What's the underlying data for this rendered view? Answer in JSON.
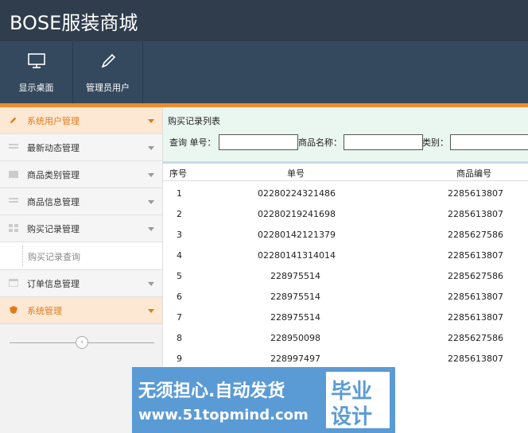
{
  "app": {
    "title": "BOSE服装商城"
  },
  "toolbar": [
    {
      "label": "显示桌面",
      "icon": "monitor-icon"
    },
    {
      "label": "管理员用户",
      "icon": "pen-icon"
    }
  ],
  "sidebar": {
    "items": [
      {
        "label": "系统用户管理",
        "icon": "pencil-icon",
        "active": true
      },
      {
        "label": "最新动态管理",
        "icon": "list-icon"
      },
      {
        "label": "商品类别管理",
        "icon": "folder-icon"
      },
      {
        "label": "商品信息管理",
        "icon": "list-icon"
      },
      {
        "label": "购买记录管理",
        "icon": "grid-icon"
      },
      {
        "label": "订单信息管理",
        "icon": "calendar-icon"
      },
      {
        "label": "系统管理",
        "icon": "shield-icon",
        "active": true
      }
    ],
    "sub_item": "购买记录查询",
    "collapse_glyph": "‹"
  },
  "panel": {
    "title": "购买记录列表",
    "search": {
      "label_prefix": "查询 单号：",
      "product_name_label": "商品名称：",
      "category_label": "类别："
    }
  },
  "table": {
    "columns": [
      "序号",
      "单号",
      "商品编号"
    ],
    "rows": [
      [
        "1",
        "02280224321486",
        "2285613807"
      ],
      [
        "2",
        "02280219241698",
        "2285613807"
      ],
      [
        "3",
        "02280142121379",
        "2285627586"
      ],
      [
        "4",
        "02280141314014",
        "2285613807"
      ],
      [
        "5",
        "228975514",
        "2285627586"
      ],
      [
        "6",
        "228975514",
        "2285613807"
      ],
      [
        "7",
        "228975514",
        "2285613807"
      ],
      [
        "8",
        "228950098",
        "2285627586"
      ],
      [
        "9",
        "228997497",
        "2285613807"
      ]
    ]
  },
  "watermark": {
    "line1": "无须担心.自动发货",
    "line2": "www.51topmind.com",
    "badge1": "毕业",
    "badge2": "设计"
  },
  "colors": {
    "header": "#2f3d4d",
    "toolbar": "#34495d",
    "accent": "#f08c2e",
    "watermark": "#5b9bd5"
  }
}
